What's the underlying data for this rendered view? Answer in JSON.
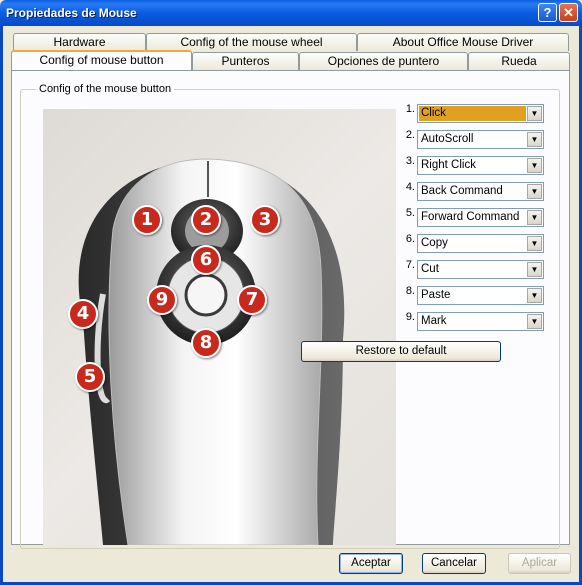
{
  "window": {
    "title": "Propiedades de Mouse",
    "help_glyph": "?",
    "close_glyph": "✕"
  },
  "tabs_back": [
    "Hardware",
    "Config of the mouse wheel",
    "About Office Mouse Driver"
  ],
  "tabs_front": [
    "Config of mouse button",
    "Punteros",
    "Opciones de puntero",
    "Rueda"
  ],
  "active_tab": "Config of mouse button",
  "group": {
    "legend": "Config of the mouse button"
  },
  "badges": [
    "1",
    "2",
    "3",
    "4",
    "5",
    "6",
    "7",
    "8",
    "9"
  ],
  "buttons": [
    {
      "num": "1.",
      "value": "Click"
    },
    {
      "num": "2.",
      "value": "AutoScroll"
    },
    {
      "num": "3.",
      "value": "Right Click"
    },
    {
      "num": "4.",
      "value": "Back Command"
    },
    {
      "num": "5.",
      "value": "Forward Command"
    },
    {
      "num": "6.",
      "value": "Copy"
    },
    {
      "num": "7.",
      "value": "Cut"
    },
    {
      "num": "8.",
      "value": "Paste"
    },
    {
      "num": "9.",
      "value": "Mark"
    }
  ],
  "restore_label": "Restore to default",
  "dialog_buttons": {
    "ok": "Aceptar",
    "cancel": "Cancelar",
    "apply": "Aplicar"
  },
  "colors": {
    "badge": "#c8291c",
    "selection": "#e0a020",
    "titlebar": "#0a5ce0"
  }
}
